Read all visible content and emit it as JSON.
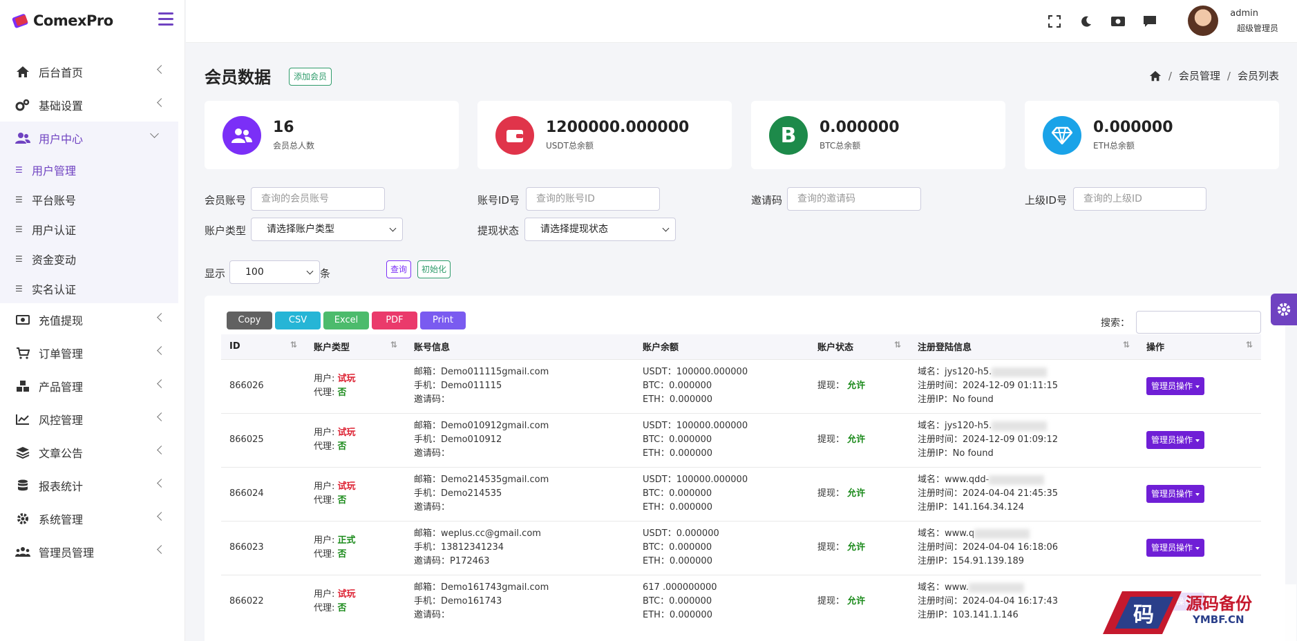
{
  "brand": {
    "name": "ComexPro"
  },
  "sidebar": {
    "items": [
      {
        "label": "后台首页",
        "icon": "home-icon"
      },
      {
        "label": "基础设置",
        "icon": "cogs-icon"
      },
      {
        "label": "用户中心",
        "icon": "users-icon"
      },
      {
        "label": "充值提现",
        "icon": "money-icon"
      },
      {
        "label": "订单管理",
        "icon": "cart-icon"
      },
      {
        "label": "产品管理",
        "icon": "cubes-icon"
      },
      {
        "label": "风控管理",
        "icon": "chart-line-icon"
      },
      {
        "label": "文章公告",
        "icon": "layers-icon"
      },
      {
        "label": "报表统计",
        "icon": "database-icon"
      },
      {
        "label": "系统管理",
        "icon": "gear-icon"
      },
      {
        "label": "管理员管理",
        "icon": "group-icon"
      }
    ],
    "sub_items": [
      "用户管理",
      "平台账号",
      "用户认证",
      "资金变动",
      "实名认证"
    ]
  },
  "topbar": {
    "user_name": "admin",
    "user_role": "超级管理员"
  },
  "page": {
    "title": "会员数据",
    "add_button": "添加会员"
  },
  "breadcrumb": {
    "level1": "会员管理",
    "level2": "会员列表",
    "sep": "/"
  },
  "stats": [
    {
      "value": "16",
      "label": "会员总人数",
      "color": "#7b2ff7"
    },
    {
      "value": "1200000.000000",
      "label": "USDT总余额",
      "color": "#e0344a"
    },
    {
      "value": "0.000000",
      "label": "BTC总余额",
      "color": "#1d8a4a",
      "letter": "B"
    },
    {
      "value": "0.000000",
      "label": "ETH总余额",
      "color": "#1aa3e8"
    }
  ],
  "filters": {
    "account_label": "会员账号",
    "account_ph": "查询的会员账号",
    "id_label": "账号ID号",
    "id_ph": "查询的账号ID",
    "invite_label": "邀请码",
    "invite_ph": "查询的邀请码",
    "parent_label": "上级ID号",
    "parent_ph": "查询的上级ID",
    "type_label": "账户类型",
    "type_value": "请选择账户类型",
    "withdraw_label": "提现状态",
    "withdraw_value": "请选择提现状态",
    "show_label": "显示",
    "show_value": "100",
    "show_unit": "条",
    "query_btn": "查询",
    "reset_btn": "初始化"
  },
  "export": {
    "copy": "Copy",
    "csv": "CSV",
    "excel": "Excel",
    "pdf": "PDF",
    "print": "Print"
  },
  "search": {
    "label": "搜索："
  },
  "table": {
    "headers": [
      "ID",
      "账户类型",
      "账号信息",
      "账户余额",
      "账户状态",
      "注册登陆信息",
      "操作"
    ],
    "rows": [
      {
        "id": "866026",
        "user_prefix": "用户: ",
        "user_type": "试玩",
        "agent_prefix": "代理: ",
        "agent": "否",
        "email": "邮箱：Demo011115gmail.com",
        "phone": "手机：Demo011115",
        "invite": "邀请码：",
        "usdt": "USDT：100000.000000",
        "btc": "BTC：0.000000",
        "eth": "ETH：0.000000",
        "status_prefix": "提现：",
        "status": "允许",
        "domain": "域名：jys120-h5.",
        "reg_time": "注册时间：2024-12-09 01:11:15",
        "reg_ip": "注册IP：No found",
        "action": "管理员操作"
      },
      {
        "id": "866025",
        "user_prefix": "用户: ",
        "user_type": "试玩",
        "agent_prefix": "代理: ",
        "agent": "否",
        "email": "邮箱：Demo010912gmail.com",
        "phone": "手机：Demo010912",
        "invite": "邀请码：",
        "usdt": "USDT：100000.000000",
        "btc": "BTC：0.000000",
        "eth": "ETH：0.000000",
        "status_prefix": "提现：",
        "status": "允许",
        "domain": "域名：jys120-h5.",
        "reg_time": "注册时间：2024-12-09 01:09:12",
        "reg_ip": "注册IP：No found",
        "action": "管理员操作"
      },
      {
        "id": "866024",
        "user_prefix": "用户: ",
        "user_type": "试玩",
        "agent_prefix": "代理: ",
        "agent": "否",
        "email": "邮箱：Demo214535gmail.com",
        "phone": "手机：Demo214535",
        "invite": "邀请码：",
        "usdt": "USDT：100000.000000",
        "btc": "BTC：0.000000",
        "eth": "ETH：0.000000",
        "status_prefix": "提现：",
        "status": "允许",
        "domain": "域名：www.qdd-",
        "reg_time": "注册时间：2024-04-04 21:45:35",
        "reg_ip": "注册IP：141.164.34.124",
        "action": "管理员操作"
      },
      {
        "id": "866023",
        "user_prefix": "用户: ",
        "user_type": "正式",
        "agent_prefix": "代理: ",
        "agent": "否",
        "email": "邮箱：weplus.cc@gmail.com",
        "phone": "手机：13812341234",
        "invite": "邀请码：P172463",
        "usdt": "USDT：0.000000",
        "btc": "BTC：0.000000",
        "eth": "ETH：0.000000",
        "status_prefix": "提现：",
        "status": "允许",
        "domain": "域名：www.q",
        "reg_time": "注册时间：2024-04-04 16:18:06",
        "reg_ip": "注册IP：154.91.139.189",
        "action": "管理员操作"
      },
      {
        "id": "866022",
        "user_prefix": "用户: ",
        "user_type": "试玩",
        "agent_prefix": "代理: ",
        "agent": "否",
        "email": "邮箱：Demo161743gmail.com",
        "phone": "手机：Demo161743",
        "invite": "邀请码：",
        "usdt": "617        .000000000",
        "btc": "BTC：0.000000",
        "eth": "ETH：0.000000",
        "status_prefix": "提现：",
        "status": "允许",
        "domain": "域名：www.",
        "reg_time": "注册时间：2024-04-04 16:17:43",
        "reg_ip": "注册IP：103.141.1.146",
        "action": "管理员操作"
      }
    ]
  },
  "watermark": {
    "cn": "源码备份",
    "en": "YMBF.CN",
    "glyph": "码"
  }
}
